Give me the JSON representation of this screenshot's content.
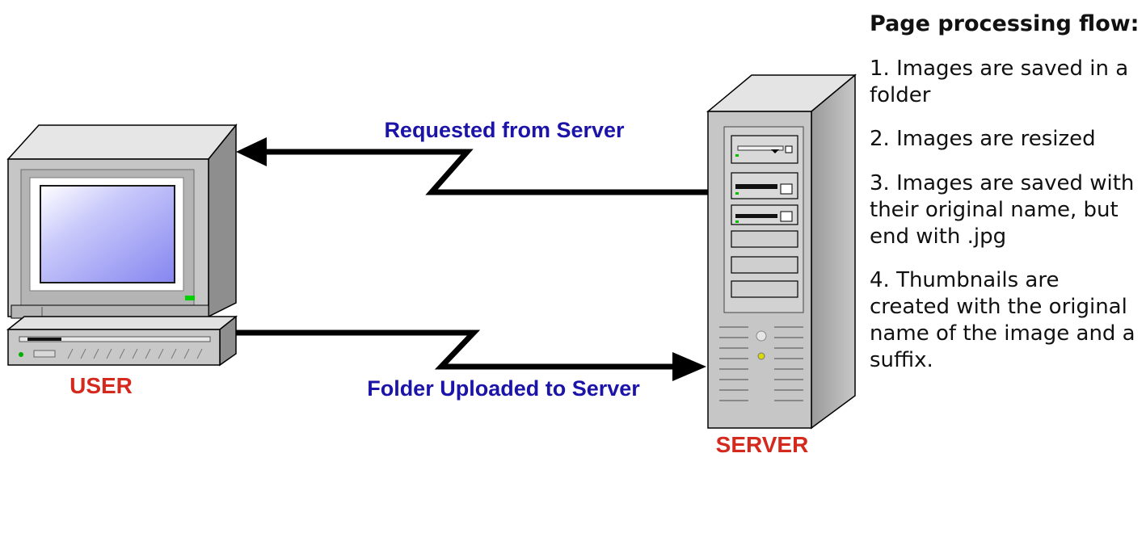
{
  "diagram": {
    "user_label": "USER",
    "server_label": "SERVER",
    "request_label": "Requested from Server",
    "upload_label": "Folder Uploaded to Server",
    "colors": {
      "user_label": "#d42a1e",
      "server_label": "#d42a1e",
      "arrow_labels": "#1c14a8",
      "arrows": "#000000",
      "screen": "#8f8ff2"
    },
    "icons": [
      "desktop-computer-icon",
      "tower-server-icon"
    ]
  },
  "panel": {
    "title": "Page processing flow:",
    "steps": [
      "1. Images are saved in a folder",
      "2. Images are resized",
      "3. Images are saved with their original name, but end with .jpg",
      "4. Thumbnails are created with the original name of the image and a suffix."
    ]
  }
}
